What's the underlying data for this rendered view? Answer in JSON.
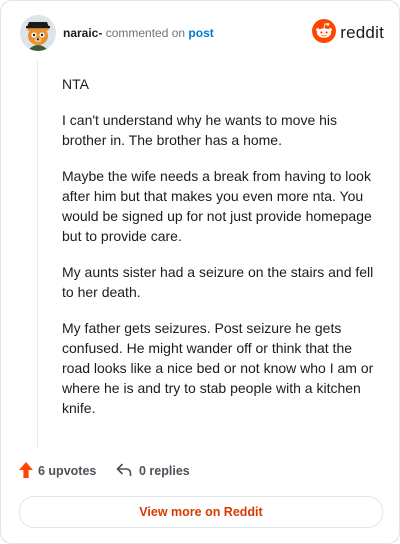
{
  "header": {
    "username": "naraic-",
    "action_text": " commented on ",
    "post_link": "post",
    "brand_name": "reddit",
    "brand_color": "#ff4500"
  },
  "comment": {
    "paragraphs": [
      "NTA",
      "I can't understand why he wants to move his brother in. The brother has a home.",
      "Maybe the wife needs a break from having to look after him but that makes you even more nta. You would be signed up for not just provide homepage but to provide care.",
      "My aunts sister had a seizure on the stairs and fell to her death.",
      "My father gets seizures. Post seizure he gets confused. He might wander off or think that the road looks like a nice bed or not know who I am or where he is and try to stab people with a kitchen knife."
    ]
  },
  "actions": {
    "upvotes_label": "6 upvotes",
    "replies_label": "0 replies",
    "upvote_color": "#ff4500"
  },
  "footer": {
    "view_more_label": "View more on Reddit"
  }
}
